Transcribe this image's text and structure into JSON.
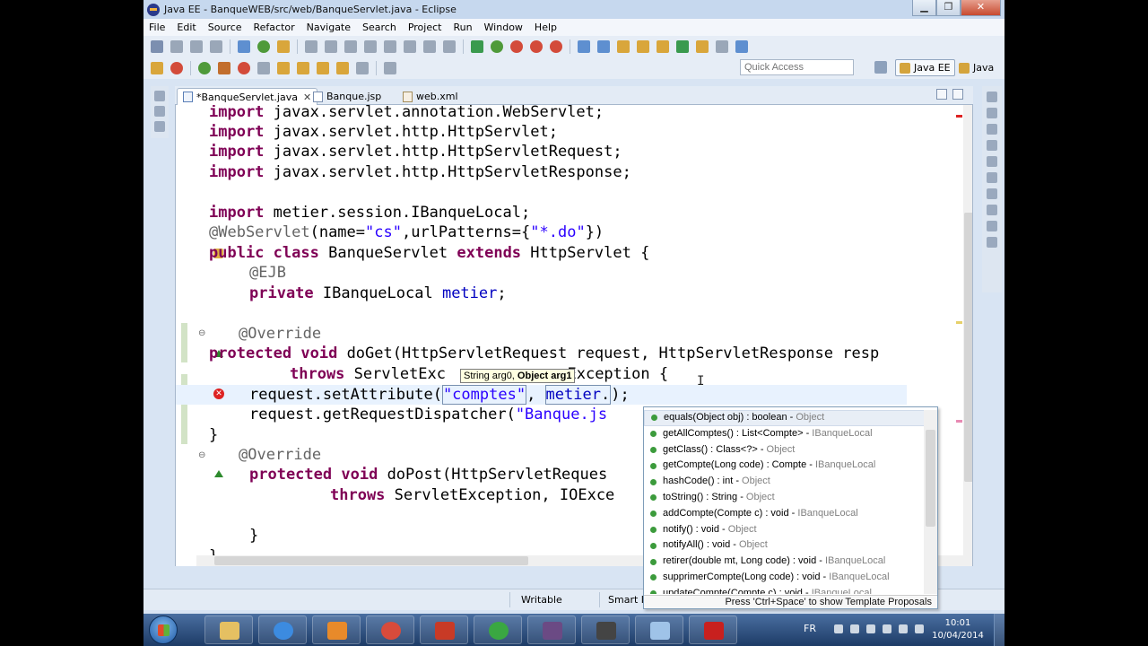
{
  "window": {
    "title": "Java EE - BanqueWEB/src/web/BanqueServlet.java - Eclipse",
    "minimize": "▁",
    "maximize": "❐",
    "close": "✕"
  },
  "menu": [
    "File",
    "Edit",
    "Source",
    "Refactor",
    "Navigate",
    "Search",
    "Project",
    "Run",
    "Window",
    "Help"
  ],
  "quick_access": {
    "placeholder": "Quick Access"
  },
  "perspectives": {
    "javaee": "Java EE",
    "java": "Java"
  },
  "tabs": [
    {
      "label": "*BanqueServlet.java",
      "close": "✕",
      "active": true
    },
    {
      "label": "Banque.jsp",
      "active": false
    },
    {
      "label": "web.xml",
      "active": false
    }
  ],
  "code": {
    "l1_kw": "import",
    "l1_rest": " javax.servlet.annotation.WebServlet;",
    "l2_kw": "import",
    "l2_rest": " javax.servlet.http.HttpServlet;",
    "l3_kw": "import",
    "l3_rest": " javax.servlet.http.HttpServletRequest;",
    "l4_kw": "import",
    "l4_rest": " javax.servlet.http.HttpServletResponse;",
    "l5_kw": "import",
    "l5_rest": " metier.session.IBanqueLocal;",
    "l6_ann": "@WebServlet",
    "l6_a": "(name=",
    "l6_s1": "\"cs\"",
    "l6_b": ",urlPatterns={",
    "l6_s2": "\"*.do\"",
    "l6_c": "})",
    "l7_kw1": "public",
    "l7_kw2": "class",
    "l7_a": " BanqueServlet ",
    "l7_kw3": "extends",
    "l7_b": " HttpServlet {",
    "l8_ann": "@EJB",
    "l9_kw": "private",
    "l9_a": " IBanqueLocal ",
    "l9_fld": "metier",
    "l9_b": ";",
    "l10_ann": "@Override",
    "l11_kw1": "protected",
    "l11_kw2": "void",
    "l11_a": " doGet(HttpServletRequest request, HttpServletResponse resp",
    "l12_kw": "throws",
    "l12_a": " ServletExc",
    "l12_b": "  Exception {",
    "l13_a": "request.setAttribute(",
    "l13_s": "\"comptes\"",
    "l13_b": ", ",
    "l13_fld": "metier",
    "l13_c": ".",
    "l13_d": ");",
    "l14_a": "request.getRequestDispatcher(",
    "l14_s": "\"Banque.js",
    "l15": "}",
    "l16_ann": "@Override",
    "l17_kw1": "protected",
    "l17_kw2": "void",
    "l17_a": " doPost(HttpServletReques",
    "l18_kw": "throws",
    "l18_a": " ServletException, IOExce",
    "l19": "}",
    "l20": "}"
  },
  "param_hint": {
    "prefix": "String arg0, ",
    "bold": "Object arg1"
  },
  "assist": {
    "proposals": [
      {
        "sig": "equals(Object obj) : boolean",
        "qual": "Object",
        "sep": " - "
      },
      {
        "sig": "getAllComptes() : List<Compte>",
        "qual": "IBanqueLocal",
        "sep": " - "
      },
      {
        "sig": "getClass() : Class<?>",
        "qual": "Object",
        "sep": " - "
      },
      {
        "sig": "getCompte(Long code) : Compte",
        "qual": "IBanqueLocal",
        "sep": " - "
      },
      {
        "sig": "hashCode() : int",
        "qual": "Object",
        "sep": " - "
      },
      {
        "sig": "toString() : String",
        "qual": "Object",
        "sep": " - "
      },
      {
        "sig": "addCompte(Compte c) : void",
        "qual": "IBanqueLocal",
        "sep": " - "
      },
      {
        "sig": "notify() : void",
        "qual": "Object",
        "sep": " - "
      },
      {
        "sig": "notifyAll() : void",
        "qual": "Object",
        "sep": " - "
      },
      {
        "sig": "retirer(double mt, Long code) : void",
        "qual": "IBanqueLocal",
        "sep": " - "
      },
      {
        "sig": "supprimerCompte(Long code) : void",
        "qual": "IBanqueLocal",
        "sep": " - "
      },
      {
        "sig": "updateCompte(Compte c) : void",
        "qual": "IBanqueLocal",
        "sep": " - "
      }
    ],
    "footer": "Press 'Ctrl+Space' to show Template Proposals"
  },
  "status": {
    "writable": "Writable",
    "insert": "Smart In"
  },
  "tray": {
    "lang": "FR",
    "time": "10:01",
    "date": "10/04/2014"
  },
  "icons": [
    "eclipse-icon",
    "save-icon",
    "debug-icon",
    "run-icon",
    "external-tools-icon",
    "new-server-icon",
    "search-icon"
  ],
  "colors": {
    "keyword": "#7f0055",
    "string": "#2a00ff",
    "annotation": "#646464",
    "field": "#0000c0"
  }
}
